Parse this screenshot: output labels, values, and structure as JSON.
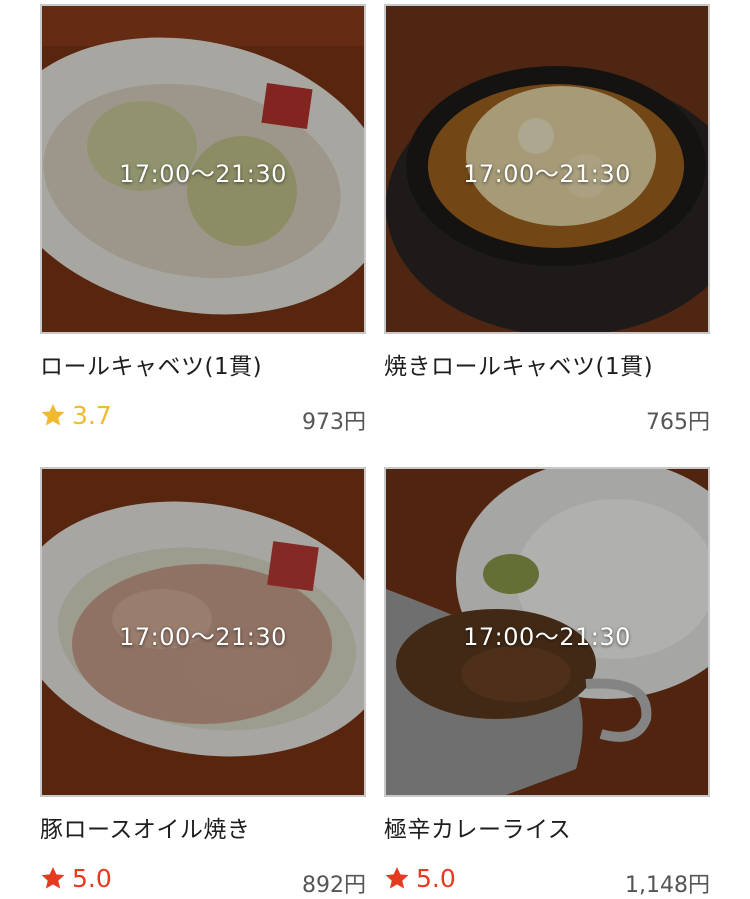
{
  "items": [
    {
      "hours": "17:00〜21:30",
      "name": "ロールキャベツ(1貫)",
      "rating": "3.7",
      "rating_color": "#f0b92e",
      "price": "973円"
    },
    {
      "hours": "17:00〜21:30",
      "name": "焼きロールキャベツ(1貫)",
      "rating": "",
      "rating_color": "",
      "price": "765円"
    },
    {
      "hours": "17:00〜21:30",
      "name": "豚ロースオイル焼き",
      "rating": "5.0",
      "rating_color": "#e63a20",
      "price": "892円"
    },
    {
      "hours": "17:00〜21:30",
      "name": "極辛カレーライス",
      "rating": "5.0",
      "rating_color": "#e63a20",
      "price": "1,148円"
    }
  ],
  "icons": {
    "rating": "star-icon"
  }
}
